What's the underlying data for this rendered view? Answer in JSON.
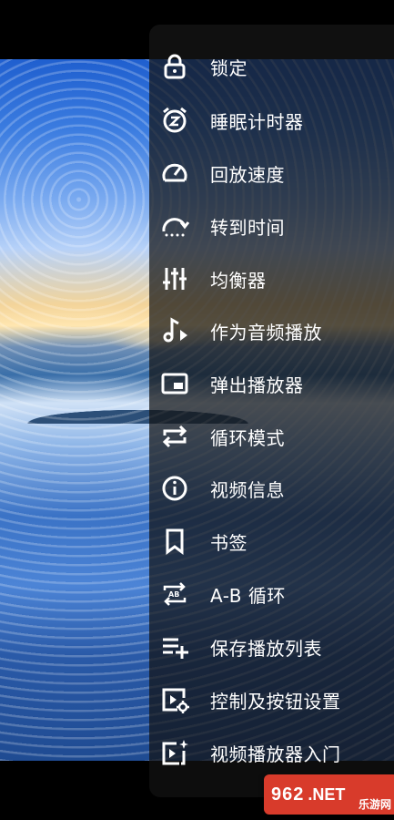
{
  "menu": {
    "items": [
      {
        "label": "锁定",
        "icon": "lock-icon"
      },
      {
        "label": "睡眠计时器",
        "icon": "sleep-timer-icon"
      },
      {
        "label": "回放速度",
        "icon": "speed-icon"
      },
      {
        "label": "转到时间",
        "icon": "goto-time-icon"
      },
      {
        "label": "均衡器",
        "icon": "equalizer-icon"
      },
      {
        "label": "作为音频播放",
        "icon": "audio-play-icon"
      },
      {
        "label": "弹出播放器",
        "icon": "popup-player-icon"
      },
      {
        "label": "循环模式",
        "icon": "repeat-icon"
      },
      {
        "label": "视频信息",
        "icon": "info-icon"
      },
      {
        "label": "书签",
        "icon": "bookmark-icon"
      },
      {
        "label": "A-B 循环",
        "icon": "ab-repeat-icon"
      },
      {
        "label": "保存播放列表",
        "icon": "save-playlist-icon"
      },
      {
        "label": "控制及按钮设置",
        "icon": "controls-settings-icon"
      },
      {
        "label": "视频播放器入门",
        "icon": "player-tutorial-icon"
      }
    ]
  },
  "watermark": {
    "number": "962",
    "domain": ".NET",
    "chinese": "乐游网"
  },
  "colors": {
    "menu_bg": "#121212",
    "icon": "#ffffff",
    "logo": "#d83b2b"
  }
}
